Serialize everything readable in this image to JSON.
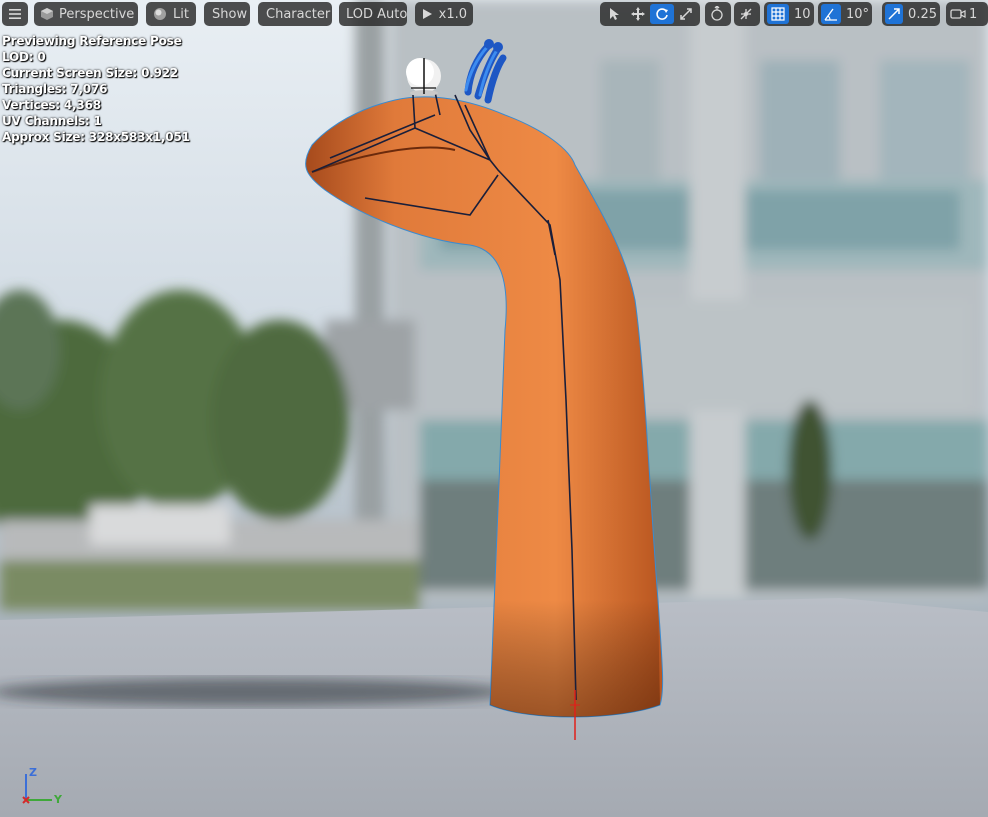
{
  "toolbar": {
    "menu_icon": "hamburger-icon",
    "view_mode": "Perspective",
    "lighting": "Lit",
    "show": "Show",
    "character": "Character",
    "lod": "LOD Auto",
    "play_speed": "x1.0",
    "transform_tools": [
      "select-arrow-icon",
      "translate-icon",
      "rotate-icon",
      "scale-icon"
    ],
    "active_tool": "rotate-icon",
    "coordinate_icon": "world-icon",
    "surface_snap_icon": "surface-snap-icon",
    "grid_snap": "10",
    "rotation_snap": "10°",
    "scale_snap": "0.25",
    "camera_speed": "1"
  },
  "stats": {
    "line1": "Previewing Reference Pose",
    "line2": "LOD: 0",
    "line3": "Current Screen Size: 0.922",
    "line4": "Triangles: 7,076",
    "line5": "Vertices: 4,368",
    "line6": "UV Channels: 1",
    "line7": "Approx Size: 328x583x1,051"
  },
  "axis": {
    "z": "Z",
    "y": "Y",
    "x": "X"
  },
  "colors": {
    "accent": "#1f73d6",
    "mesh": "#e07a3a",
    "ground": "#aeb3bb"
  }
}
